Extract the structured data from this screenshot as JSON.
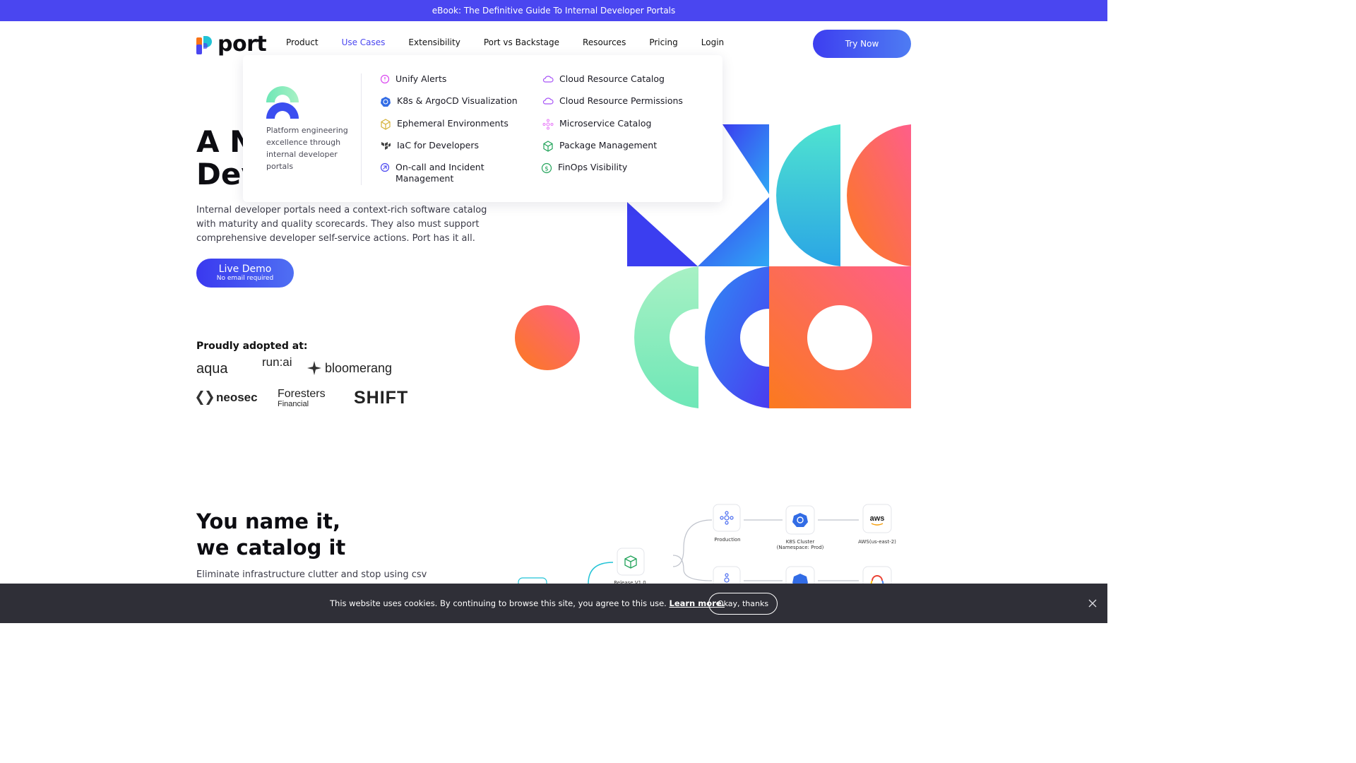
{
  "banner": {
    "text": "eBook: The Definitive Guide To Internal Developer Portals"
  },
  "header": {
    "logo_text": "port",
    "nav": [
      {
        "label": "Product"
      },
      {
        "label": "Use Cases"
      },
      {
        "label": "Extensibility"
      },
      {
        "label": "Port vs Backstage"
      },
      {
        "label": "Resources"
      },
      {
        "label": "Pricing"
      },
      {
        "label": "Login"
      }
    ],
    "try_label": "Try Now"
  },
  "hero": {
    "title_line1": "A N",
    "title_line2": "Dev",
    "description": "Internal developer portals need a context-rich software catalog with maturity and quality scorecards. They also must support comprehensive developer self-service actions. Port has it all.",
    "demo_label": "Live Demo",
    "demo_sub": "No email required"
  },
  "adopted": {
    "heading": "Proudly adopted at:",
    "logos": [
      "aqua",
      "run:ai",
      "bloomerang",
      "neosec",
      "Foresters",
      "Financial",
      "SHIFT"
    ]
  },
  "dropdown": {
    "tagline": "Platform engineering excellence through internal developer portals",
    "left_items": [
      {
        "label": "Unify Alerts",
        "icon": "alert-icon",
        "color": "#d946ef"
      },
      {
        "label": "K8s & ArgoCD Visualization",
        "icon": "kubernetes-icon",
        "color": "#326ce5"
      },
      {
        "label": "Ephemeral Environments",
        "icon": "cube-icon",
        "color": "#d4b23a"
      },
      {
        "label": "IaC for Developers",
        "icon": "iac-icon",
        "color": "#444444"
      },
      {
        "label": "On-call and Incident Management",
        "icon": "incident-icon",
        "color": "#4a46f0"
      }
    ],
    "right_items": [
      {
        "label": "Cloud Resource Catalog",
        "icon": "cloud-icon",
        "color": "#a855f7"
      },
      {
        "label": "Cloud Resource Permissions",
        "icon": "cloud-icon",
        "color": "#a855f7"
      },
      {
        "label": "Microservice Catalog",
        "icon": "microservice-icon",
        "color": "#e879f9"
      },
      {
        "label": "Package Management",
        "icon": "package-icon",
        "color": "#22a35a"
      },
      {
        "label": "FinOps Visibility",
        "icon": "dollar-icon",
        "color": "#22a35a"
      }
    ]
  },
  "section2": {
    "title_line1": "You name it,",
    "title_line2": "we catalog it",
    "description": "Eliminate infrastructure clutter and stop using csv"
  },
  "diagram": {
    "production": "Production",
    "k8s_cluster": "K8S Cluster",
    "k8s_namespace": "(Namespace: Prod)",
    "aws_label": "AWS(us-east-2)",
    "aws_logo": "aws",
    "release": "Release V1.0"
  },
  "cookie": {
    "text": "This website uses cookies. By continuing to browse this site, you agree to this use.",
    "link": "Learn more.",
    "button": "Okay, thanks"
  },
  "colors": {
    "brand": "#4a46f0",
    "cookie_bg": "#2f2f37"
  }
}
